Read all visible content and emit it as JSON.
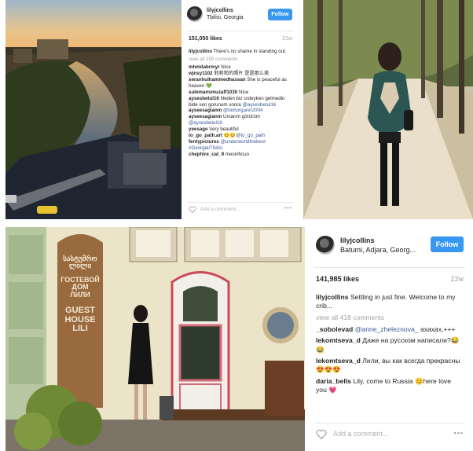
{
  "post1": {
    "username": "lilyjcollins",
    "location": "Tbilisi, Georgia",
    "follow_label": "Follow",
    "likes": "151,050 likes",
    "time": "21w",
    "caption_user": "lilyjcollins",
    "caption_text": "There's no shame in standing out.",
    "view_all": "view all 299 comments",
    "comments": [
      {
        "user": "mhmdabrmyr",
        "text": "Nice"
      },
      {
        "user": "wjnsy1102",
        "text": "莉莉和的照片 是是那么美"
      },
      {
        "user": "seranhulhammedhassan",
        "text": "She is peaceful as heaven 💚"
      },
      {
        "user": "sulemansmuzaff1030",
        "text": "Nice"
      },
      {
        "user": "aysesbetul16",
        "text": "Neden biz ordeyken gelmedin bide sen gorunum sonra",
        "mention": "@aysesbetul16"
      },
      {
        "user": "ayseesagianm",
        "text": "Neden biz ordeyken gelmedin bide sen gorunum sonra",
        "mention": "@bohorgurer2004"
      },
      {
        "user": "ayseesagianm",
        "text": "Umarım görürüm",
        "mention": "@aysesbetul16"
      },
      {
        "user": "yeesage",
        "text": "Very beautiful"
      },
      {
        "user": "to_go_path.art",
        "text": "😊😊",
        "mention": "@to_go_path"
      },
      {
        "user": "fentypictures",
        "text": "@underworldthebest #Georgia/Tbilisi"
      },
      {
        "user": "chephire_cat_9",
        "text": "meonlhcuo"
      }
    ],
    "add_comment": "Add a comment...",
    "more": "•••"
  },
  "post2": {
    "username": "lilyjcollins",
    "location": "Batumi, Adjara, Georg...",
    "follow_label": "Follow",
    "likes": "141,985 likes",
    "time": "22w",
    "caption_user": "lilyjcollins",
    "caption_text": "Settling in just fine. Welcome to my crib...",
    "view_all": "view all 418 comments",
    "comments": [
      {
        "user": "_sobolevad",
        "mention": "@anne_zheleznova_",
        "text": "ахахах,+++"
      },
      {
        "user": "lekomtseva_d",
        "text": "Даже на русском написали?😂😂"
      },
      {
        "user": "lekomtseva_d",
        "text": "Лили, вы как всегда прекрасны😍😍😍"
      },
      {
        "user": "daria_bells",
        "text": "Lily, come to Russia 😊here love you 💗"
      }
    ],
    "add_comment": "Add a comment...",
    "more": "•••"
  },
  "sign": {
    "georgian1": "სასტუმრო",
    "georgian2": "ლილი",
    "russian1": "ГОСТЕВОЙ",
    "russian2": "ДОМ",
    "russian3": "ЛИЛИ",
    "english1": "GUEST",
    "english2": "HOUSE",
    "english3": "LILI"
  },
  "colors": {
    "follow_blue": "#3897f0",
    "mention_blue": "#3b5998"
  }
}
